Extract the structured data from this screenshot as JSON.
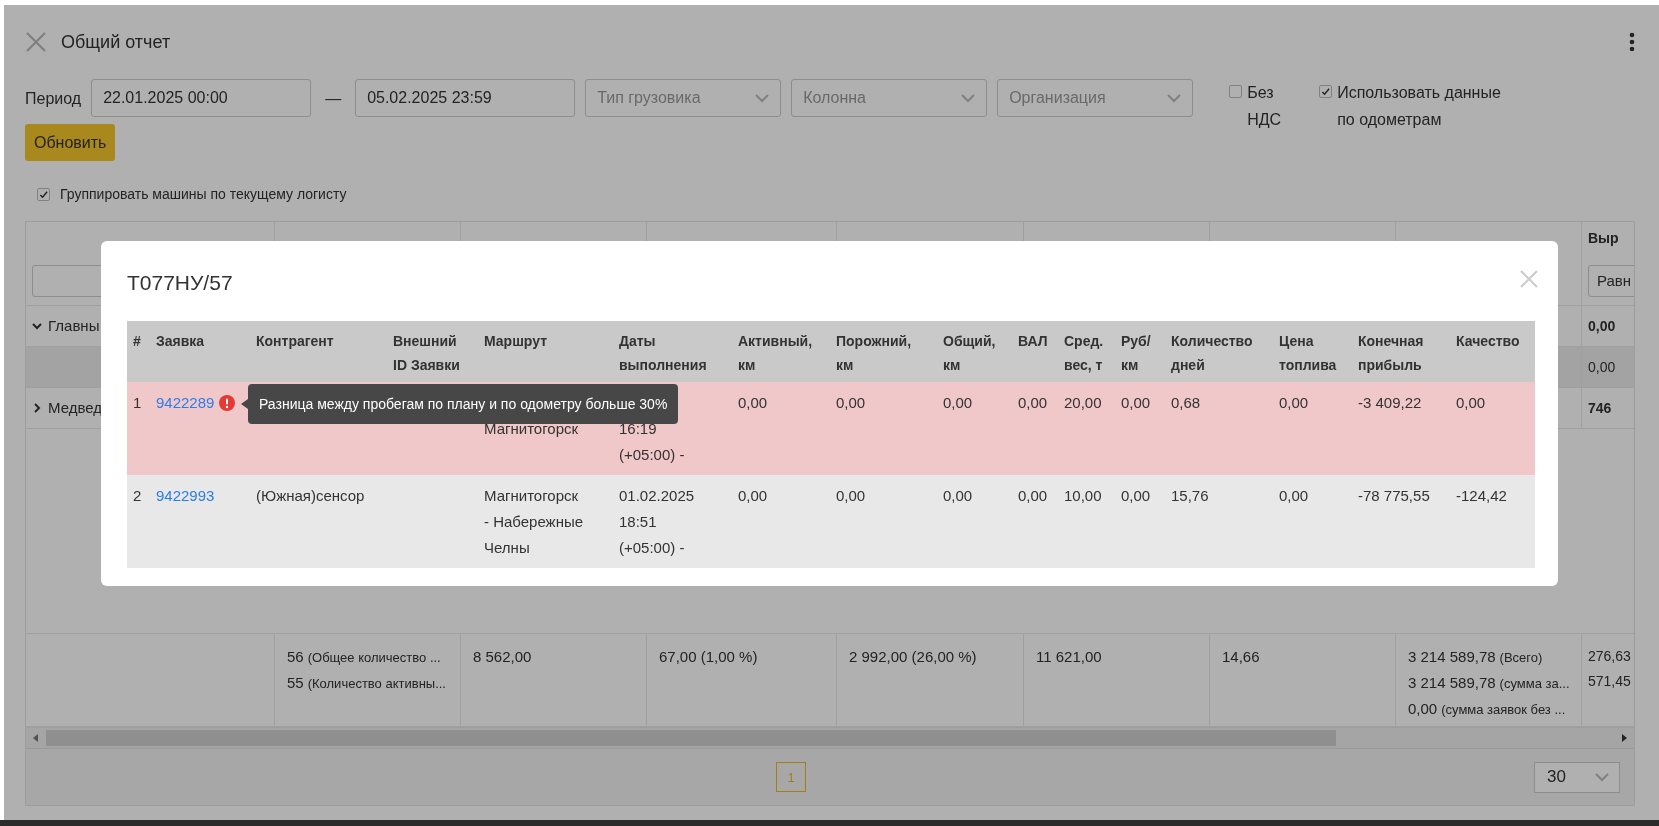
{
  "header": {
    "title": "Общий отчет"
  },
  "filters": {
    "period_label": "Период",
    "date_from": "22.01.2025 00:00",
    "separator": "—",
    "date_to": "05.02.2025 23:59",
    "selects": [
      {
        "placeholder": "Тип грузовика"
      },
      {
        "placeholder": "Колонна"
      },
      {
        "placeholder": "Организация"
      }
    ],
    "options": [
      {
        "label": "Без НДС",
        "checked": false
      },
      {
        "label": "Использовать данные по одометрам",
        "checked": true
      }
    ],
    "refresh_button": "Обновить",
    "group_option": {
      "label": "Группировать машины по текущему логисту",
      "checked": true
    }
  },
  "report": {
    "last_column": {
      "header": "Выр",
      "filter": "Равн"
    },
    "rows": [
      {
        "kind": "group",
        "label": "Главны",
        "expanded": true,
        "last_value": "0,00"
      },
      {
        "kind": "item",
        "last_value": "0,00"
      },
      {
        "kind": "group",
        "label": "Медвед",
        "expanded": false,
        "last_value": "746"
      }
    ],
    "totals": [
      [
        {
          "value": "56",
          "note": "(Общее количество ..."
        },
        {
          "value": "55",
          "note": "(Количество активны..."
        }
      ],
      [
        {
          "value": "8 562,00"
        }
      ],
      [
        {
          "value": "67,00 (1,00 %)"
        }
      ],
      [
        {
          "value": "2 992,00 (26,00 %)"
        }
      ],
      [
        {
          "value": "11 621,00"
        }
      ],
      [
        {
          "value": "14,66"
        }
      ],
      [
        {
          "value": "3 214 589,78",
          "note": "(Всего)"
        },
        {
          "value": "3 214 589,78",
          "note": "(сумма за..."
        },
        {
          "value": "0,00",
          "note": "(сумма заявок без ..."
        }
      ],
      [
        {
          "value": "276,63"
        },
        {
          "value": "571,45"
        }
      ]
    ],
    "pages": [
      {
        "label": "1",
        "selected": true
      }
    ],
    "page_size": "30"
  },
  "dialog": {
    "title": "Т077НУ/57",
    "columns": [
      "#",
      "Заявка",
      "Контрагент",
      "Внешний ID Заявки",
      "Маршрут",
      "Даты выполнения",
      "Активный, км",
      "Порожний, км",
      "Общий, км",
      "ВАЛ",
      "Сред. вес, т",
      "Руб/км",
      "Количество дней",
      "Цена топлива",
      "Конечная прибыль",
      "Качество"
    ],
    "rows": [
      {
        "warning": true,
        "cells": [
          "1",
          "9422289",
          null,
          null,
          {
            "text": "Магнитогорск",
            "under_tooltip": true
          },
          {
            "text": "16:19\n(+05:00) -",
            "under_tooltip": true
          },
          "0,00",
          "0,00",
          "0,00",
          "0,00",
          "20,00",
          "0,00",
          "0,68",
          "0,00",
          "-3 409,22",
          "0,00"
        ]
      },
      {
        "warning": false,
        "cells": [
          "2",
          "9422993",
          "(Южная)сенсор",
          null,
          "Магнитогорск - Набережные Челны",
          "01.02.2025 18:51 (+05:00) -",
          "0,00",
          "0,00",
          "0,00",
          "0,00",
          "10,00",
          "0,00",
          "15,76",
          "0,00",
          "-78 775,55",
          "-124,42"
        ]
      }
    ],
    "tooltip": "Разница между пробегам по плану и по одометру больше 30%"
  }
}
